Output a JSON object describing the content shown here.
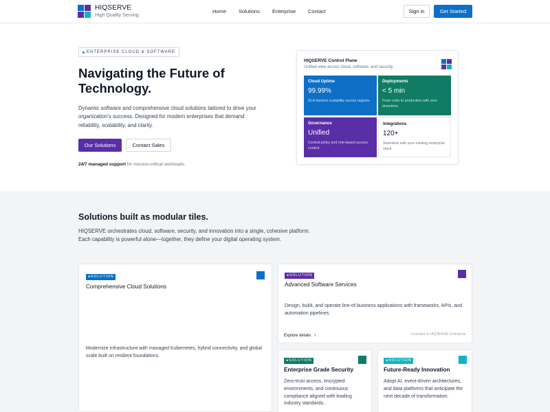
{
  "colors": {
    "primary_blue": "#0d6fc6",
    "purple": "#5a2ea6",
    "green": "#0f7c63",
    "cyan": "#13b3c2",
    "teal": "#0d9488"
  },
  "nav": {
    "brand": "HIQSERVE",
    "tagline": "High Quality Serving",
    "links": [
      "Home",
      "Solutions",
      "Enterprise",
      "Contact"
    ],
    "sign_in": "Sign in",
    "get_started": "Get Started"
  },
  "hero": {
    "pill": "ENTERPRISE CLOUD & SOFTWARE",
    "title": "Navigating the Future of Technology.",
    "description": "Dynamic software and comprehensive cloud solutions tailored to drive your organization's success. Designed for modern enterprises that demand reliability, scalability, and clarity.",
    "btn_primary": "Our Solutions",
    "btn_secondary": "Contact Sales",
    "support_bold": "24/7 managed support",
    "support_rest": " for mission-critical workloads."
  },
  "control_plane": {
    "title": "HIQSERVE Control Plane",
    "subtitle": "Unified view across cloud, software, and security.",
    "tiles": [
      {
        "label": "Cloud Uptime",
        "value": "99.99%",
        "desc": "SLA-backed scalability across regions."
      },
      {
        "label": "Deployments",
        "value": "< 5 min",
        "desc": "From code to production with zero downtime."
      },
      {
        "label": "Governance",
        "value": "Unified",
        "desc": "Central policy and role-based access control."
      },
      {
        "label": "Integrations",
        "value": "120+",
        "desc": "Seamless with your existing enterprise stack."
      }
    ]
  },
  "solutions": {
    "title": "Solutions built as modular tiles.",
    "description": "HIQSERVE orchestrates cloud, software, security, and innovation into a single, cohesive platform. Each capability is powerful alone—together, they define your digital operating system.",
    "tag": "SOLUTION",
    "cards": [
      {
        "title": "Comprehensive Cloud Solutions",
        "desc": "Modernize infrastructure with managed Kubernetes, hybrid connectivity, and global scale built on resilient foundations."
      },
      {
        "title": "Advanced Software Services",
        "desc": "Design, build, and operate line-of-business applications with frameworks, APIs, and automation pipelines.",
        "explore": "Explore details",
        "included": "Included in HIQSERVE Enterprise"
      },
      {
        "title": "Enterprise Grade Security",
        "desc": "Zero-trust access, encrypted environments, and continuous compliance aligned with leading industry standards."
      },
      {
        "title": "Future-Ready Innovation",
        "desc": "Adopt AI, event-driven architectures, and data platforms that anticipate the next decade of transformation."
      }
    ]
  }
}
